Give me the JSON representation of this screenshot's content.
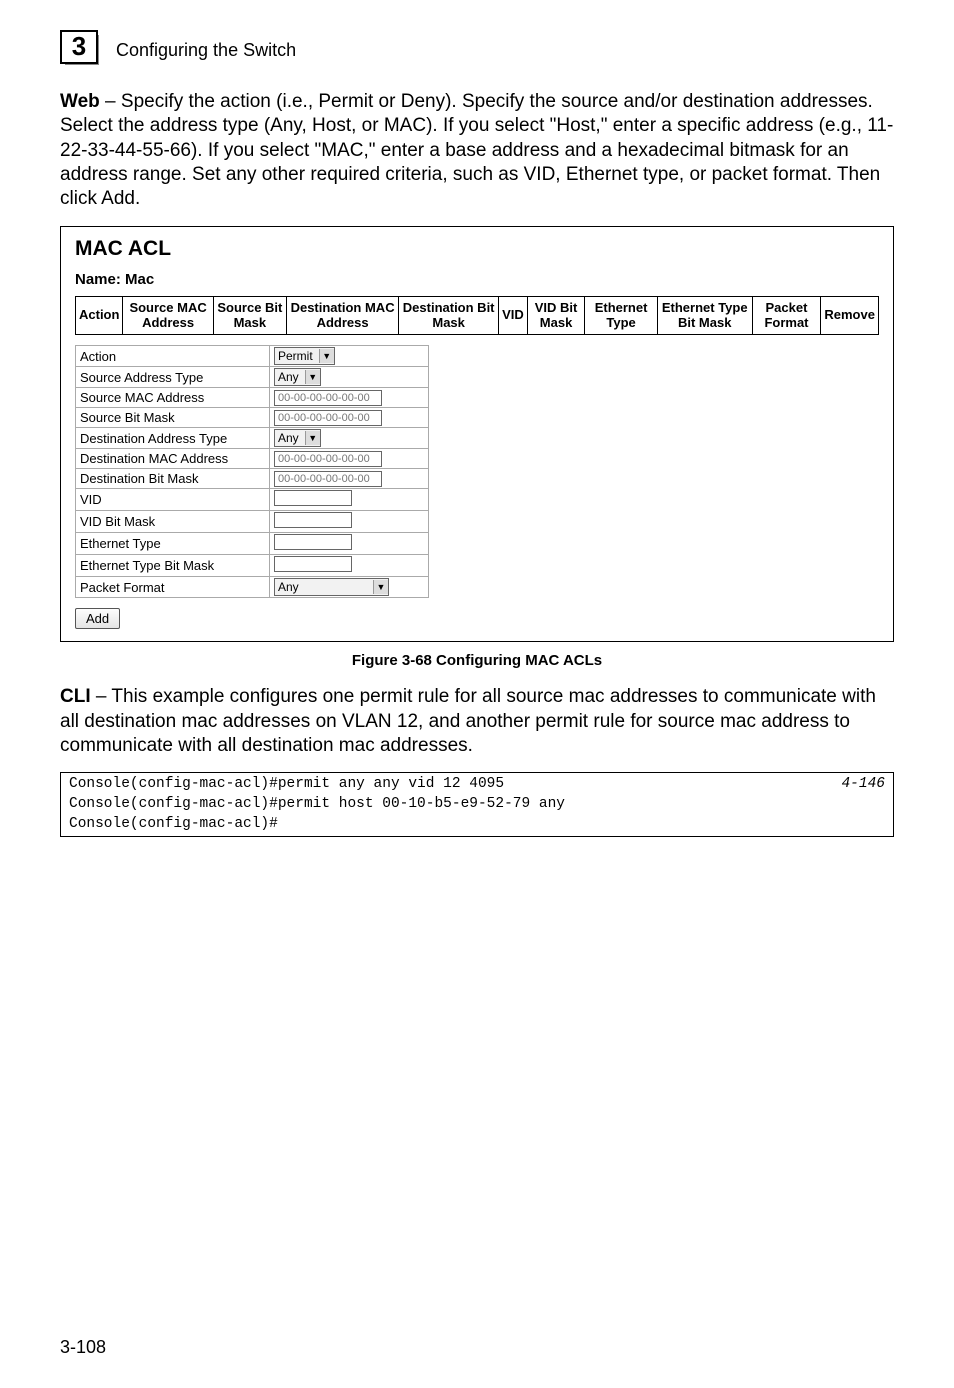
{
  "chapter": {
    "number": "3",
    "title": "Configuring the Switch"
  },
  "intro": {
    "label": "Web",
    "text": " – Specify the action (i.e., Permit or Deny). Specify the source and/or destination addresses. Select the address type (Any, Host, or MAC). If you select \"Host,\" enter a specific address (e.g., 11-22-33-44-55-66). If you select \"MAC,\" enter a base address and a hexadecimal bitmask for an address range. Set any other required criteria, such as VID, Ethernet type, or packet format. Then click Add."
  },
  "panel": {
    "title": "MAC ACL",
    "name_label": "Name:",
    "name_value": "Mac",
    "columns": {
      "c0": "Action",
      "c1": "Source\nMAC\nAddress",
      "c2": "Source\nBit Mask",
      "c3": "Destination\nMAC Address",
      "c4": "Destination\nBit Mask",
      "c5": "VID",
      "c6": "VID\nBit\nMask",
      "c7": "Ethernet\nType",
      "c8": "Ethernet\nType Bit\nMask",
      "c9": "Packet\nFormat",
      "c10": "Remove"
    },
    "form": {
      "rows": {
        "action": {
          "label": "Action",
          "value": "Permit"
        },
        "src_addr_type": {
          "label": "Source Address Type",
          "value": "Any"
        },
        "src_mac": {
          "label": "Source MAC Address",
          "value": "00-00-00-00-00-00"
        },
        "src_mask": {
          "label": "Source Bit Mask",
          "value": "00-00-00-00-00-00"
        },
        "dst_addr_type": {
          "label": "Destination Address Type",
          "value": "Any"
        },
        "dst_mac": {
          "label": "Destination MAC Address",
          "value": "00-00-00-00-00-00"
        },
        "dst_mask": {
          "label": "Destination Bit Mask",
          "value": "00-00-00-00-00-00"
        },
        "vid": {
          "label": "VID",
          "value": ""
        },
        "vid_mask": {
          "label": "VID Bit Mask",
          "value": ""
        },
        "eth_type": {
          "label": "Ethernet Type",
          "value": ""
        },
        "eth_type_mask": {
          "label": "Ethernet Type Bit Mask",
          "value": ""
        },
        "pkt_fmt": {
          "label": "Packet Format",
          "value": "Any"
        }
      }
    },
    "add_button": "Add"
  },
  "figure_caption": "Figure 3-68  Configuring MAC ACLs",
  "cli": {
    "label": "CLI",
    "text": " – This example configures one permit rule for all source mac addresses to communicate with all destination mac addresses on VLAN 12, and another permit rule for source mac address to communicate with all destination mac addresses.",
    "ref": "4-146",
    "lines": "Console(config-mac-acl)#permit any any vid 12 4095\nConsole(config-mac-acl)#permit host 00-10-b5-e9-52-79 any\nConsole(config-mac-acl)#"
  },
  "footer": "3-108"
}
